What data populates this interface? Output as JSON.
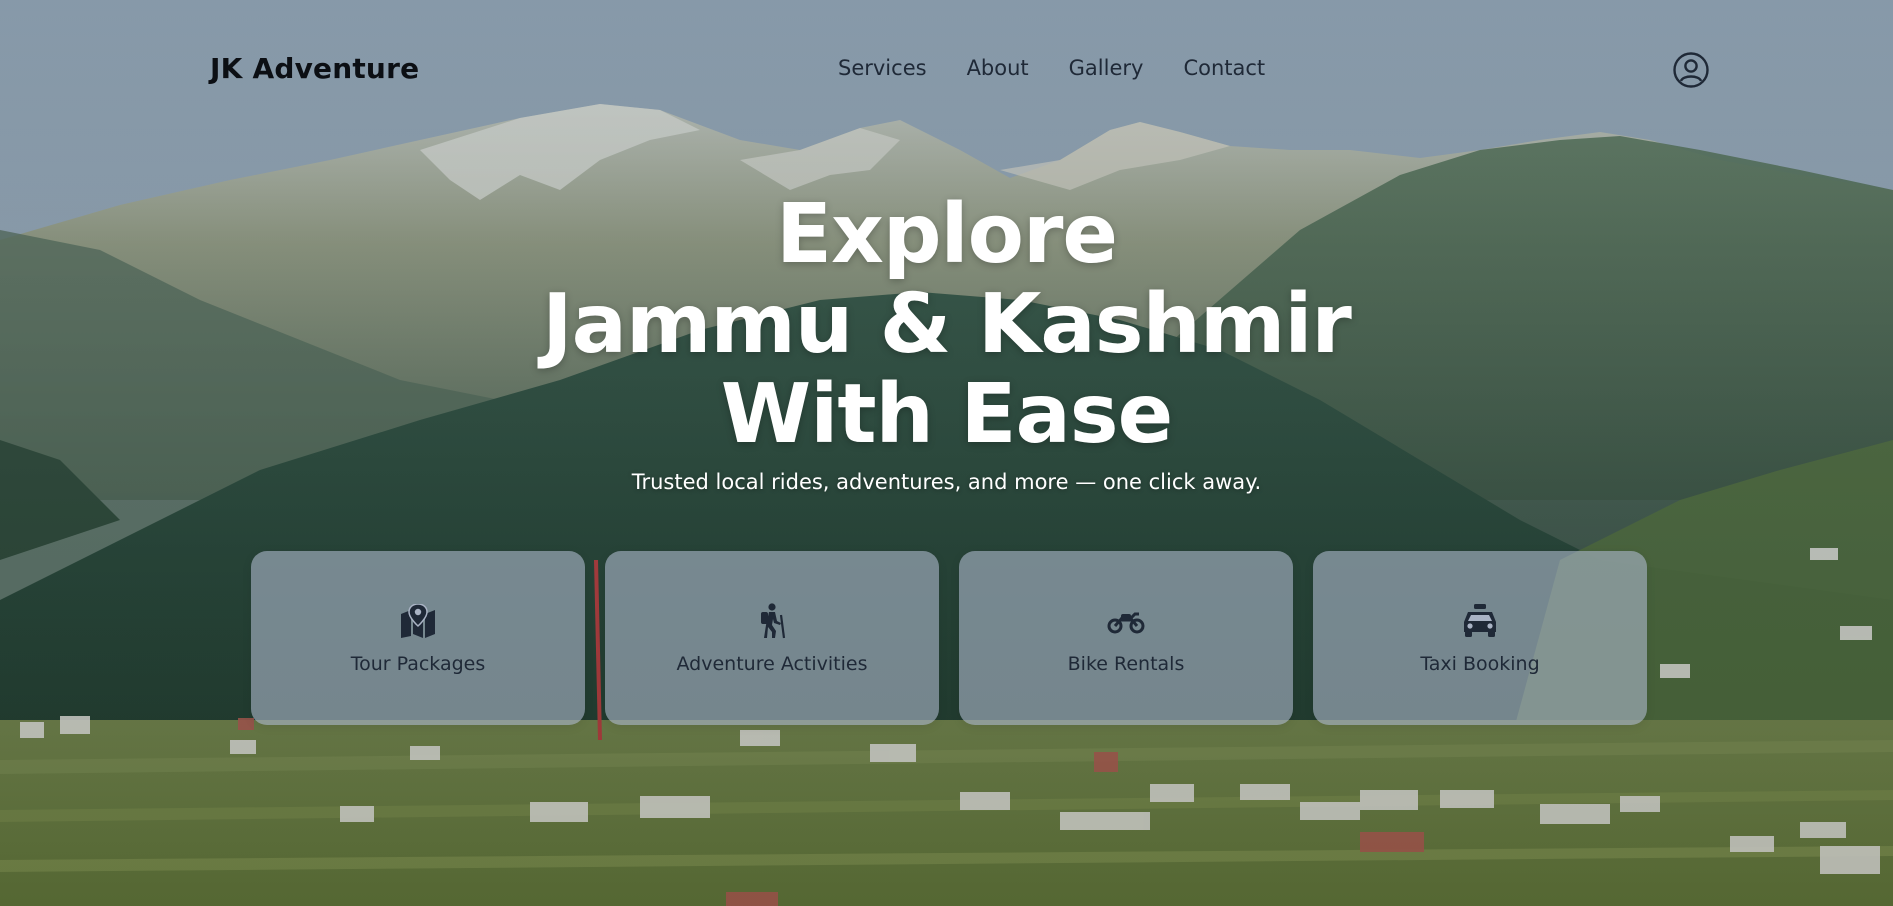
{
  "brand": {
    "name": "JK Adventure"
  },
  "nav": {
    "items": [
      {
        "label": "Services"
      },
      {
        "label": "About"
      },
      {
        "label": "Gallery"
      },
      {
        "label": "Contact"
      }
    ],
    "user_icon": "user-circle-icon"
  },
  "hero": {
    "title_lines": [
      "Explore",
      "Jammu & Kashmir",
      "With Ease"
    ],
    "subtitle": "Trusted local rides, adventures, and more — one click away."
  },
  "services": [
    {
      "label": "Tour Packages",
      "icon": "map-pin-icon"
    },
    {
      "label": "Adventure Activities",
      "icon": "hiker-icon"
    },
    {
      "label": "Bike Rentals",
      "icon": "motorcycle-icon"
    },
    {
      "label": "Taxi Booking",
      "icon": "taxi-icon"
    }
  ],
  "colors": {
    "hero_text": "#ffffff",
    "nav_text": "#1f2937",
    "logo_text": "#0c0f14",
    "card_bg": "rgba(170,180,200,0.62)"
  }
}
